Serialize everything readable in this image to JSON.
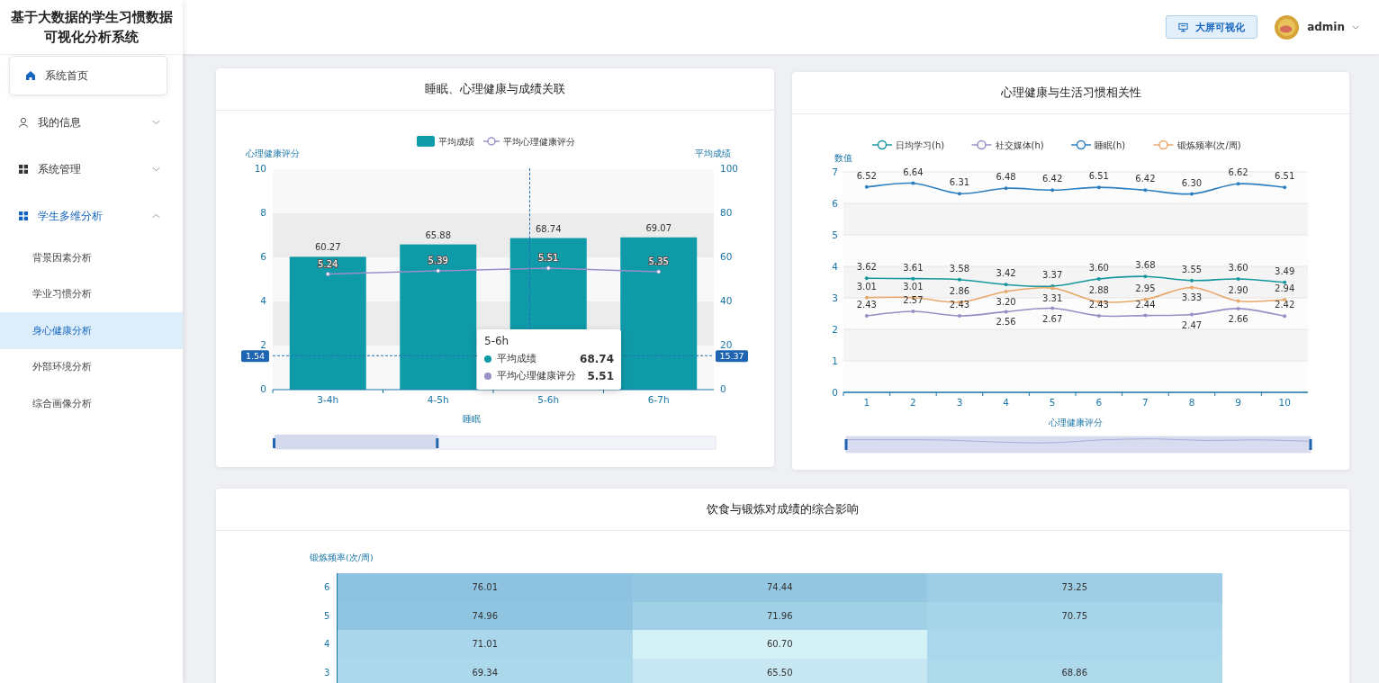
{
  "sidebar": {
    "title": "基于大数据的学生习惯数据可视化分析系统",
    "menu": [
      {
        "label": "系统首页",
        "kind": "home"
      },
      {
        "label": "我的信息",
        "kind": "account",
        "expanded": false
      },
      {
        "label": "系统管理",
        "kind": "module",
        "expanded": false
      },
      {
        "label": "学生多维分析",
        "kind": "module",
        "expanded": true,
        "children": [
          {
            "label": "背景因素分析",
            "selected": false
          },
          {
            "label": "学业习惯分析",
            "selected": false
          },
          {
            "label": "身心健康分析",
            "selected": true
          },
          {
            "label": "外部环境分析",
            "selected": false
          },
          {
            "label": "综合画像分析",
            "selected": false
          }
        ]
      }
    ]
  },
  "header": {
    "screen_button": "大屏可视化",
    "user": "admin"
  },
  "sleep_chart": {
    "title": "睡眠、心理健康与成绩关联",
    "chart_data": {
      "type": "bar",
      "categories": [
        "3-4h",
        "4-5h",
        "5-6h",
        "6-7h"
      ],
      "xlabel": "睡眠",
      "ylabel": "心理健康评分",
      "y2label": "平均成绩",
      "ylim": [
        0,
        10
      ],
      "yticks": [
        0,
        2,
        4,
        6,
        8,
        10
      ],
      "y2lim": [
        0,
        100
      ],
      "y2ticks": [
        0,
        20,
        40,
        60,
        80,
        100
      ],
      "legend": "top",
      "data_labels": true,
      "series": [
        {
          "name": "平均成绩",
          "type": "bar",
          "axis": "y2",
          "color": "#0f9aa8",
          "values": [
            60.27,
            65.88,
            68.74,
            69.07
          ],
          "value_labels": [
            "60.27",
            "65.88",
            "68.74",
            "69.07"
          ]
        },
        {
          "name": "平均心理健康评分",
          "type": "line",
          "marker": true,
          "color": "#9c8fcb",
          "values": [
            5.24,
            5.39,
            5.51,
            5.35
          ],
          "value_labels": [
            "5.24",
            "5.39",
            "5.51",
            "5.35"
          ]
        }
      ],
      "ref_lines": [
        {
          "axis": "y",
          "value": 1.54,
          "label": "1.54"
        }
      ]
    },
    "pointer": {
      "right_label": "15.37"
    },
    "tooltip": {
      "title": "5-6h",
      "rows": [
        {
          "name": "平均成绩",
          "value": "68.74"
        },
        {
          "name": "平均心理健康评分",
          "value": "5.51"
        }
      ]
    }
  },
  "habit_chart": {
    "title": "心理健康与生活习惯相关性",
    "chart_data": {
      "type": "line",
      "x": [
        "1",
        "2",
        "3",
        "4",
        "5",
        "6",
        "7",
        "8",
        "9",
        "10"
      ],
      "xlabel": "心理健康评分",
      "ylabel": "数值",
      "ylim": [
        0,
        7
      ],
      "yticks": [
        0,
        1,
        2,
        3,
        4,
        5,
        6,
        7
      ],
      "grid": true,
      "legend": "top",
      "data_labels": true,
      "series": [
        {
          "name": "日均学习(h)",
          "marker": true,
          "color": "#16979e",
          "values": [
            3.62,
            3.61,
            3.58,
            3.42,
            3.37,
            3.6,
            3.68,
            3.55,
            3.6,
            3.49
          ],
          "value_labels": [
            "3.62",
            "3.61",
            "3.58",
            "3.42",
            "3.37",
            "3.60",
            "3.68",
            "3.55",
            "3.60",
            "3.49"
          ]
        },
        {
          "name": "社交媒体(h)",
          "marker": true,
          "color": "#9a8cc4",
          "values": [
            2.43,
            2.57,
            2.43,
            2.56,
            2.67,
            2.43,
            2.44,
            2.47,
            2.66,
            2.42
          ],
          "value_labels": [
            "2.43",
            "2.57",
            "2.43",
            "2.56",
            "2.67",
            "2.43",
            "2.44",
            "2.47",
            "2.66",
            "2.42"
          ]
        },
        {
          "name": "睡眠(h)",
          "marker": true,
          "color": "#2e7fbf",
          "values": [
            6.52,
            6.64,
            6.31,
            6.48,
            6.42,
            6.51,
            6.42,
            6.3,
            6.62,
            6.51
          ],
          "value_labels": [
            "6.52",
            "6.64",
            "6.31",
            "6.48",
            "6.42",
            "6.51",
            "6.42",
            "6.30",
            "6.62",
            "6.51"
          ]
        },
        {
          "name": "锻炼频率(次/周)",
          "marker": true,
          "color": "#e9a86b",
          "values": [
            3.01,
            3.01,
            2.86,
            3.2,
            3.31,
            2.88,
            2.95,
            3.33,
            2.9,
            2.94
          ],
          "value_labels": [
            "3.01",
            "3.01",
            "2.86",
            "3.20",
            "3.31",
            "2.88",
            "2.95",
            "3.33",
            "2.90",
            "2.94"
          ]
        }
      ]
    }
  },
  "diet_chart": {
    "title": "饮食与锻炼对成绩的综合影响",
    "ylabel": "锻炼频率(次/周)",
    "rows": [
      {
        "label": "6",
        "cells": [
          {
            "value": "76.01",
            "color": "#8dc3e0"
          },
          {
            "value": "74.44",
            "color": "#94c8e2"
          },
          {
            "value": "73.25",
            "color": "#9ecde5"
          }
        ]
      },
      {
        "label": "5",
        "cells": [
          {
            "value": "74.96",
            "color": "#90c5e1"
          },
          {
            "value": "71.96",
            "color": "#a0d0e6"
          },
          {
            "value": "70.75",
            "color": "#a6d4e8"
          }
        ]
      },
      {
        "label": "4",
        "cells": [
          {
            "value": "71.01",
            "color": "#a9d6ea"
          },
          {
            "value": "60.70",
            "color": "#d4f1f6"
          },
          {
            "color": "#aad7eb"
          }
        ]
      },
      {
        "label": "3",
        "cells": [
          {
            "value": "69.34",
            "color": "#acd8eb"
          },
          {
            "value": "65.50",
            "color": "#c6e6f1"
          },
          {
            "value": "68.86",
            "color": "#add9eb"
          }
        ]
      }
    ]
  }
}
